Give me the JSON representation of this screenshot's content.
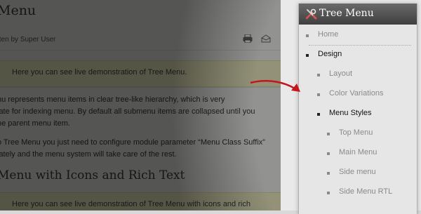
{
  "article": {
    "title": "Menu",
    "author": "tten by Super User",
    "notice_1": "Here you can see live demonstration of Tree Menu.",
    "para_1_line_1": "nu represents menu items in clear tree-like hierarchy, which is very",
    "para_1_line_2": "iate for indexing menu. By default all submenu items are collapsed until you",
    "para_1_line_3": "he parent menu item.",
    "para_2_line_1_a": "o Tree Menu you just need to configure module parameter ",
    "para_2_line_1_b": "“Menu Class Suffix”",
    "para_2_line_2": "iately and the menu system will take care of the rest.",
    "subheading": "Menu with Icons and Rich Text",
    "notice_2": "Here you can see live demonstration of Tree Menu with icons and rich"
  },
  "tree_menu": {
    "title": "Tree Menu",
    "items": [
      {
        "label": "Home",
        "level": 0,
        "state": "muted"
      },
      {
        "label": "Design",
        "level": 0,
        "state": "active"
      },
      {
        "label": "Layout",
        "level": 1,
        "state": "muted"
      },
      {
        "label": "Color Variations",
        "level": 1,
        "state": "muted"
      },
      {
        "label": "Menu Styles",
        "level": 1,
        "state": "active"
      },
      {
        "label": "Top Menu",
        "level": 2,
        "state": "muted"
      },
      {
        "label": "Main Menu",
        "level": 2,
        "state": "muted"
      },
      {
        "label": "Side menu",
        "level": 2,
        "state": "muted"
      },
      {
        "label": "Side Menu RTL",
        "level": 2,
        "state": "muted"
      }
    ]
  },
  "icons": {
    "print": "printer-icon",
    "email": "envelope-icon",
    "menu_header": "tools-icon",
    "pointer": "curved-arrow-icon"
  },
  "colors": {
    "notice_bg": "#f6f4c9",
    "menu_header_bg": "#4f4f4f",
    "arrow": "#c4161c"
  }
}
